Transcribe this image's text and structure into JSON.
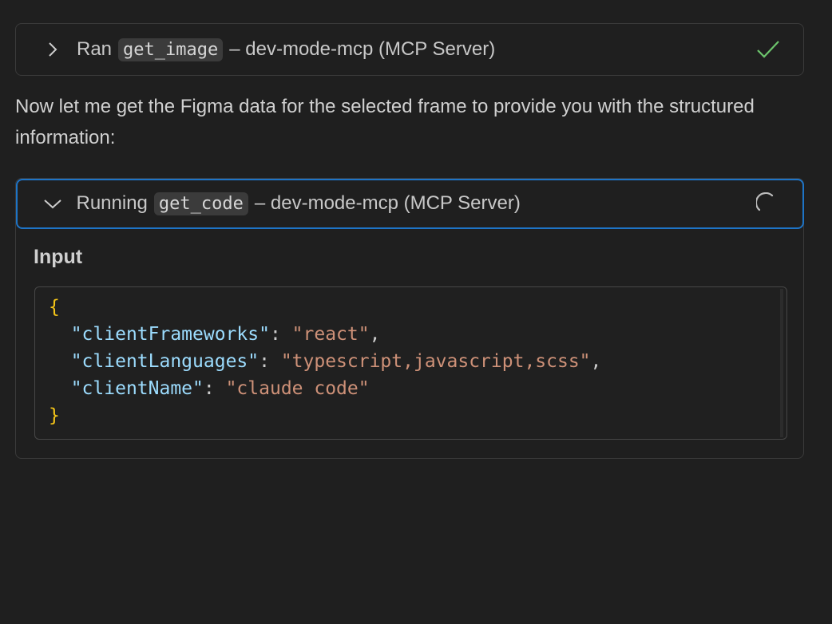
{
  "tool_calls": [
    {
      "status_word": "Ran",
      "tool_name": "get_image",
      "server_label": "– dev-mode-mcp (MCP Server)",
      "state": "completed",
      "expanded": false
    },
    {
      "status_word": "Running",
      "tool_name": "get_code",
      "server_label": "– dev-mode-mcp (MCP Server)",
      "state": "running",
      "expanded": true,
      "input_label": "Input",
      "input": {
        "open_brace": "{",
        "close_brace": "}",
        "entries": [
          {
            "key": "\"clientFrameworks\"",
            "value": "\"react\"",
            "trailing": ","
          },
          {
            "key": "\"clientLanguages\"",
            "value": "\"typescript,javascript,scss\"",
            "trailing": ","
          },
          {
            "key": "\"clientName\"",
            "value": "\"claude code\"",
            "trailing": ""
          }
        ]
      }
    }
  ],
  "message": "Now let me get the Figma data for the selected frame to provide you with the structured information:",
  "colors": {
    "background": "#1f1f1f",
    "focus_border": "#1e74c6",
    "success_check": "#6cc46c",
    "json_brace": "#f5c518",
    "json_key": "#9cdcfe",
    "json_string": "#ce9178"
  },
  "icons": {
    "card1_chevron": "chevron-right-icon",
    "card1_status": "checkmark-icon",
    "card2_chevron": "chevron-down-icon",
    "card2_status": "spinner-icon"
  }
}
